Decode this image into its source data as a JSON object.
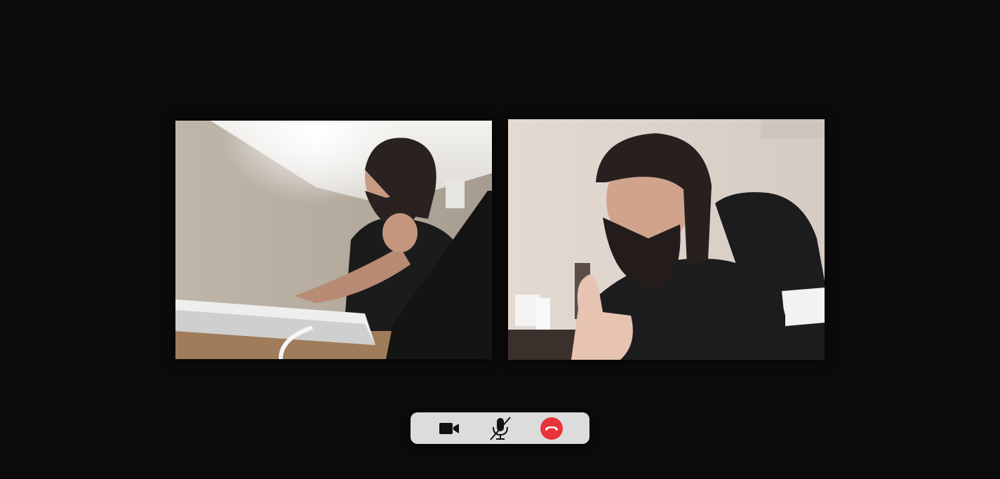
{
  "call": {
    "participants": [
      {
        "id": "participant-1",
        "video_on": true
      },
      {
        "id": "participant-2",
        "video_on": true
      }
    ],
    "controls": {
      "camera": {
        "icon": "video-camera-icon",
        "state": "on"
      },
      "microphone": {
        "icon": "microphone-muted-icon",
        "state": "muted"
      },
      "end_call": {
        "icon": "phone-hangup-icon",
        "color": "#e8333a"
      }
    }
  },
  "colors": {
    "background": "#0b0b0b",
    "control_bar": "#dcdcdc",
    "icon": "#111111",
    "end_call": "#e8333a"
  }
}
